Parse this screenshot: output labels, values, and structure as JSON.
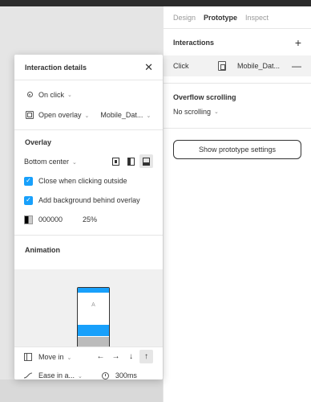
{
  "panel": {
    "tabs": [
      {
        "label": "Design"
      },
      {
        "label": "Prototype"
      },
      {
        "label": "Inspect"
      }
    ],
    "interactions_title": "Interactions",
    "interaction_row": {
      "trigger": "Click",
      "destination": "Mobile_Dat..."
    },
    "overflow_title": "Overflow scrolling",
    "overflow_value": "No scrolling",
    "proto_button": "Show prototype settings"
  },
  "modal": {
    "title": "Interaction details",
    "trigger": "On click",
    "action": "Open overlay",
    "destination": "Mobile_Dat...",
    "overlay_title": "Overlay",
    "position": "Bottom center",
    "close_outside": "Close when clicking outside",
    "add_background": "Add background behind overlay",
    "bg_color": "000000",
    "bg_opacity": "25%",
    "animation_title": "Animation",
    "preview_label": "A",
    "animation": "Move in",
    "easing": "Ease in a...",
    "duration": "300ms"
  },
  "colors": {
    "accent": "#18a0fb"
  },
  "icons": [
    "plus-icon",
    "minus-icon",
    "close-icon",
    "target-icon",
    "overlay-icon",
    "checkbox-check-icon",
    "arrow-left-icon",
    "arrow-right-icon",
    "arrow-down-icon",
    "arrow-up-icon",
    "easing-curve-icon",
    "timer-icon"
  ]
}
